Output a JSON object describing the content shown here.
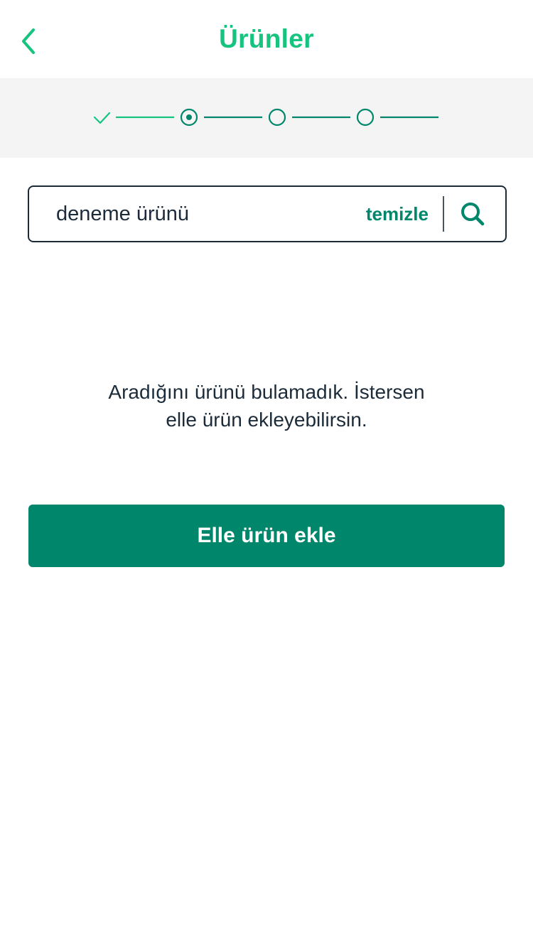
{
  "header": {
    "title": "Ürünler",
    "back_icon": "chevron-left-icon"
  },
  "stepper": {
    "steps": [
      {
        "state": "completed",
        "icon": "check-icon"
      },
      {
        "state": "current",
        "icon": "dot-circle-icon"
      },
      {
        "state": "upcoming",
        "icon": "circle-icon"
      },
      {
        "state": "upcoming",
        "icon": "circle-icon"
      }
    ]
  },
  "search": {
    "value": "deneme ürünü",
    "clear_label": "temizle",
    "icon": "search-icon"
  },
  "empty_state": {
    "line1": "Aradığını ürünü bulamadık. İstersen",
    "line2": "elle ürün ekleyebilirsin."
  },
  "actions": {
    "add_manual_label": "Elle ürün ekle"
  },
  "colors": {
    "accent_light": "#16c47f",
    "accent_dark": "#00866a",
    "text_dark": "#1c2b3a",
    "stepper_bg": "#f4f4f4"
  }
}
